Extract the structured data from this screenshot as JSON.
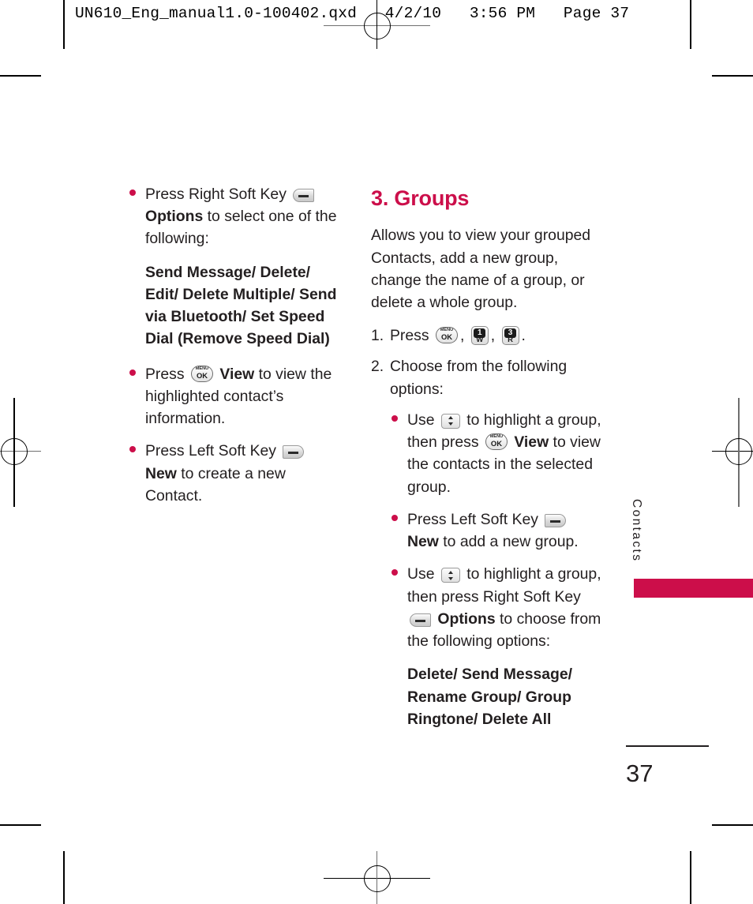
{
  "print_header": "UN610_Eng_manual1.0-100402.qxd   4/2/10   3:56 PM   Page 37",
  "colors": {
    "accent": "#cc0e4a",
    "text": "#231f20"
  },
  "left_column": {
    "bullets": [
      {
        "parts": [
          {
            "type": "text",
            "value": "Press Right Soft Key "
          },
          {
            "type": "icon",
            "icon": "soft-key-right"
          },
          {
            "type": "bold",
            "value": "Options"
          },
          {
            "type": "text",
            "value": " to select one of the following:"
          }
        ],
        "text_before_icon": "Press Right Soft Key",
        "bold_label": "Options",
        "text_after": " to select one of the following:"
      },
      {
        "text_before_icon": "Press",
        "bold_label": "View",
        "text_after": " to view the highlighted contact’s information."
      },
      {
        "text_before_icon": "Press Left Soft Key",
        "bold_label": "New",
        "text_after": " to create a new Contact."
      }
    ],
    "options_list": "Send Message/ Delete/ Edit/ Delete Multiple/ Send via Bluetooth/ Set Speed Dial (Remove Speed Dial)"
  },
  "right_column": {
    "section_title": "3. Groups",
    "intro": "Allows you to view your grouped Contacts, add a new group, change the name of a group, or delete a whole group.",
    "step1": {
      "number": "1.",
      "label": "Press",
      "keys": [
        {
          "icon": "menu-ok-key",
          "top": "MENU",
          "bottom": "OK"
        },
        {
          "icon": "keypad-key-1w",
          "digit": "1",
          "letter": "W"
        },
        {
          "icon": "keypad-key-3r",
          "digit": "3",
          "letter": "R"
        }
      ],
      "separator_1": ",",
      "separator_2": ",",
      "terminator": "."
    },
    "step2": {
      "number": "2.",
      "label": "Choose from the following options:"
    },
    "step2_bullets": [
      {
        "text_start": "Use",
        "icon_1": "nav-key",
        "text_mid": " to highlight a group, then press",
        "icon_2": "menu-ok-key",
        "bold_label": "View",
        "text_end": " to view the contacts in the selected group."
      },
      {
        "text_start": "Press Left Soft Key",
        "icon_1": "soft-key-left",
        "bold_label": "New",
        "text_end": " to add a new group."
      },
      {
        "text_start": "Use",
        "icon_1": "nav-key",
        "text_mid": " to highlight a group, then press Right Soft Key",
        "icon_2": "soft-key-right",
        "bold_label": "Options",
        "text_end": " to choose from the following options:"
      }
    ],
    "group_options_list": "Delete/ Send Message/ Rename Group/ Group Ringtone/ Delete All"
  },
  "side_tab": {
    "label": "Contacts"
  },
  "page_number": "37"
}
